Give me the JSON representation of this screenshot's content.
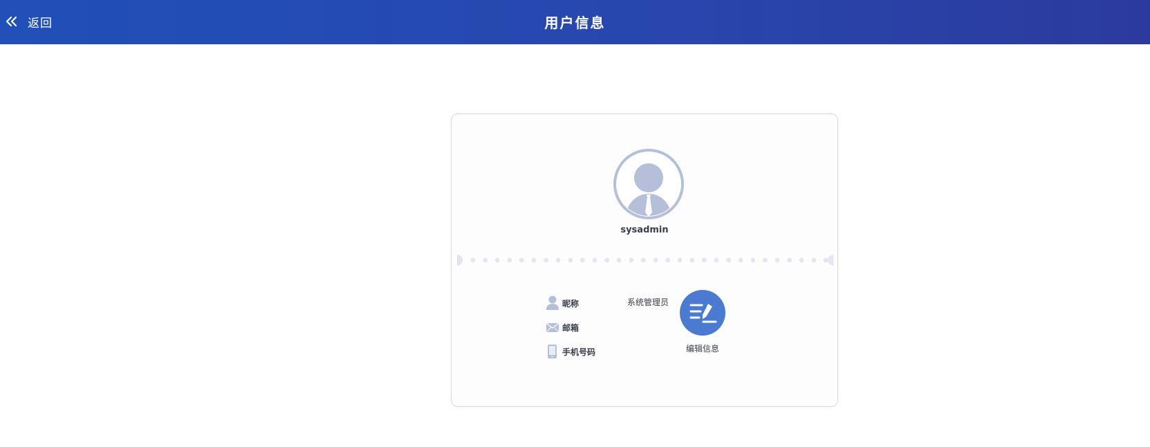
{
  "header": {
    "back_label": "返回",
    "title": "用户信息",
    "back_icon": "double-chevron-left-icon"
  },
  "profile": {
    "username": "sysadmin",
    "avatar_icon": "user-avatar-icon",
    "fields": [
      {
        "icon": "person-icon",
        "label": "昵称",
        "value": "系统管理员"
      },
      {
        "icon": "envelope-icon",
        "label": "邮箱",
        "value": ""
      },
      {
        "icon": "phone-icon",
        "label": "手机号码",
        "value": ""
      }
    ],
    "edit_label": "编辑信息",
    "edit_icon": "edit-list-pen-icon"
  },
  "colors": {
    "header_start": "#2050b8",
    "header_end": "#2c3a9e",
    "accent": "#4a7bd0",
    "icon_muted": "#b5bfd9",
    "dots": "#e4e6ee"
  }
}
